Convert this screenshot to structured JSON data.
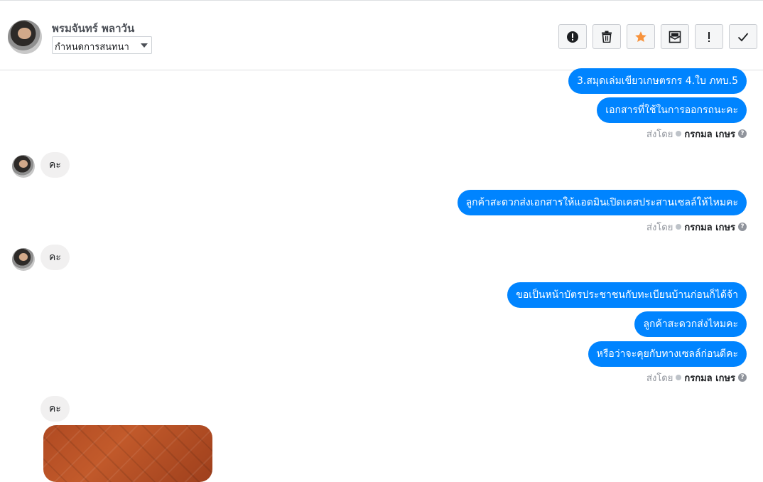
{
  "header": {
    "contact_name": "พรมจันทร์ พลาวัน",
    "conversation_menu": "กำหนดการสนทนา",
    "toolbar": [
      {
        "icon": "alert-circle-icon"
      },
      {
        "icon": "trash-icon"
      },
      {
        "icon": "star-icon",
        "color": "#f7923b"
      },
      {
        "icon": "mark-unread-icon"
      },
      {
        "icon": "exclamation-icon"
      },
      {
        "icon": "check-icon"
      }
    ]
  },
  "messages": {
    "out1": "3.สมุดเล่มเขียวเกษตรกร  4.ใบ ภทบ.5",
    "out2": "เอกสารที่ใช้ในการออกรถนะคะ",
    "sent_label": "ส่งโดย",
    "sender": "กรกมล เกษร",
    "help": "?",
    "in1": "คะ",
    "out3": "ลูกค้าสะดวกส่งเอกสารให้แอดมินเปิดเคสประสานเซลล์ให้ไหมคะ",
    "in2": "คะ",
    "out4": "ขอเป็นหน้าบัตรประชาชนกับทะเบียนบ้านก่อนก็ได้จ้า",
    "out5": "ลูกค้าสะดวกส่งไหมคะ",
    "out6": "หรือว่าจะคุยกับทางเซลล์ก่อนดีคะ",
    "in3": "คะ"
  },
  "colors": {
    "outgoing_bubble": "#0084ff",
    "incoming_bubble": "#f1f0f0",
    "star": "#f7923b"
  }
}
